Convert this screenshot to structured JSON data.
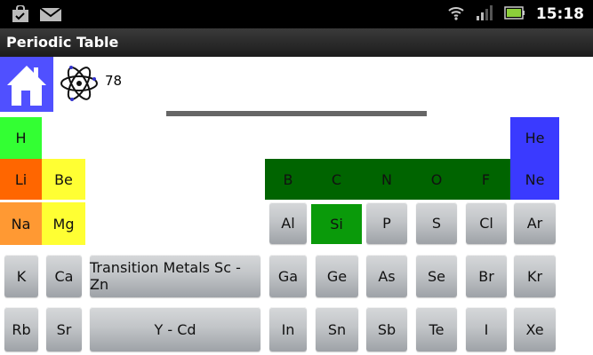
{
  "status_bar": {
    "time": "15:18",
    "icons": [
      "shopping-bag-icon",
      "mail-icon",
      "wifi-icon",
      "signal-icon",
      "battery-icon"
    ]
  },
  "app": {
    "title": "Periodic Table"
  },
  "toolbar": {
    "home_icon": "house-icon",
    "atom_icon": "atom-icon",
    "count": "78"
  },
  "progress": {
    "value": 1.0
  },
  "colors": {
    "home": "#5050ff",
    "nonmetals": "#006400",
    "alkali": "#ff6600",
    "alkaline_earth": "#ffff33",
    "noble": "#3a3aff",
    "hydrogen": "#33ff33",
    "silicon": "#0a9a0a",
    "sodium": "#ff9933"
  },
  "elements": {
    "H": "H",
    "He": "He",
    "Li": "Li",
    "Be": "Be",
    "B": "B",
    "C": "C",
    "N": "N",
    "O": "O",
    "F": "F",
    "Ne": "Ne",
    "Na": "Na",
    "Mg": "Mg",
    "Al": "Al",
    "Si": "Si",
    "P": "P",
    "S": "S",
    "Cl": "Cl",
    "Ar": "Ar",
    "K": "K",
    "Ca": "Ca",
    "TM1": "Transition Metals Sc - Zn",
    "Ga": "Ga",
    "Ge": "Ge",
    "As": "As",
    "Se": "Se",
    "Br": "Br",
    "Kr": "Kr",
    "Rb": "Rb",
    "Sr": "Sr",
    "TM2": "Y - Cd",
    "In": "In",
    "Sn": "Sn",
    "Sb": "Sb",
    "Te": "Te",
    "I": "I",
    "Xe": "Xe"
  }
}
